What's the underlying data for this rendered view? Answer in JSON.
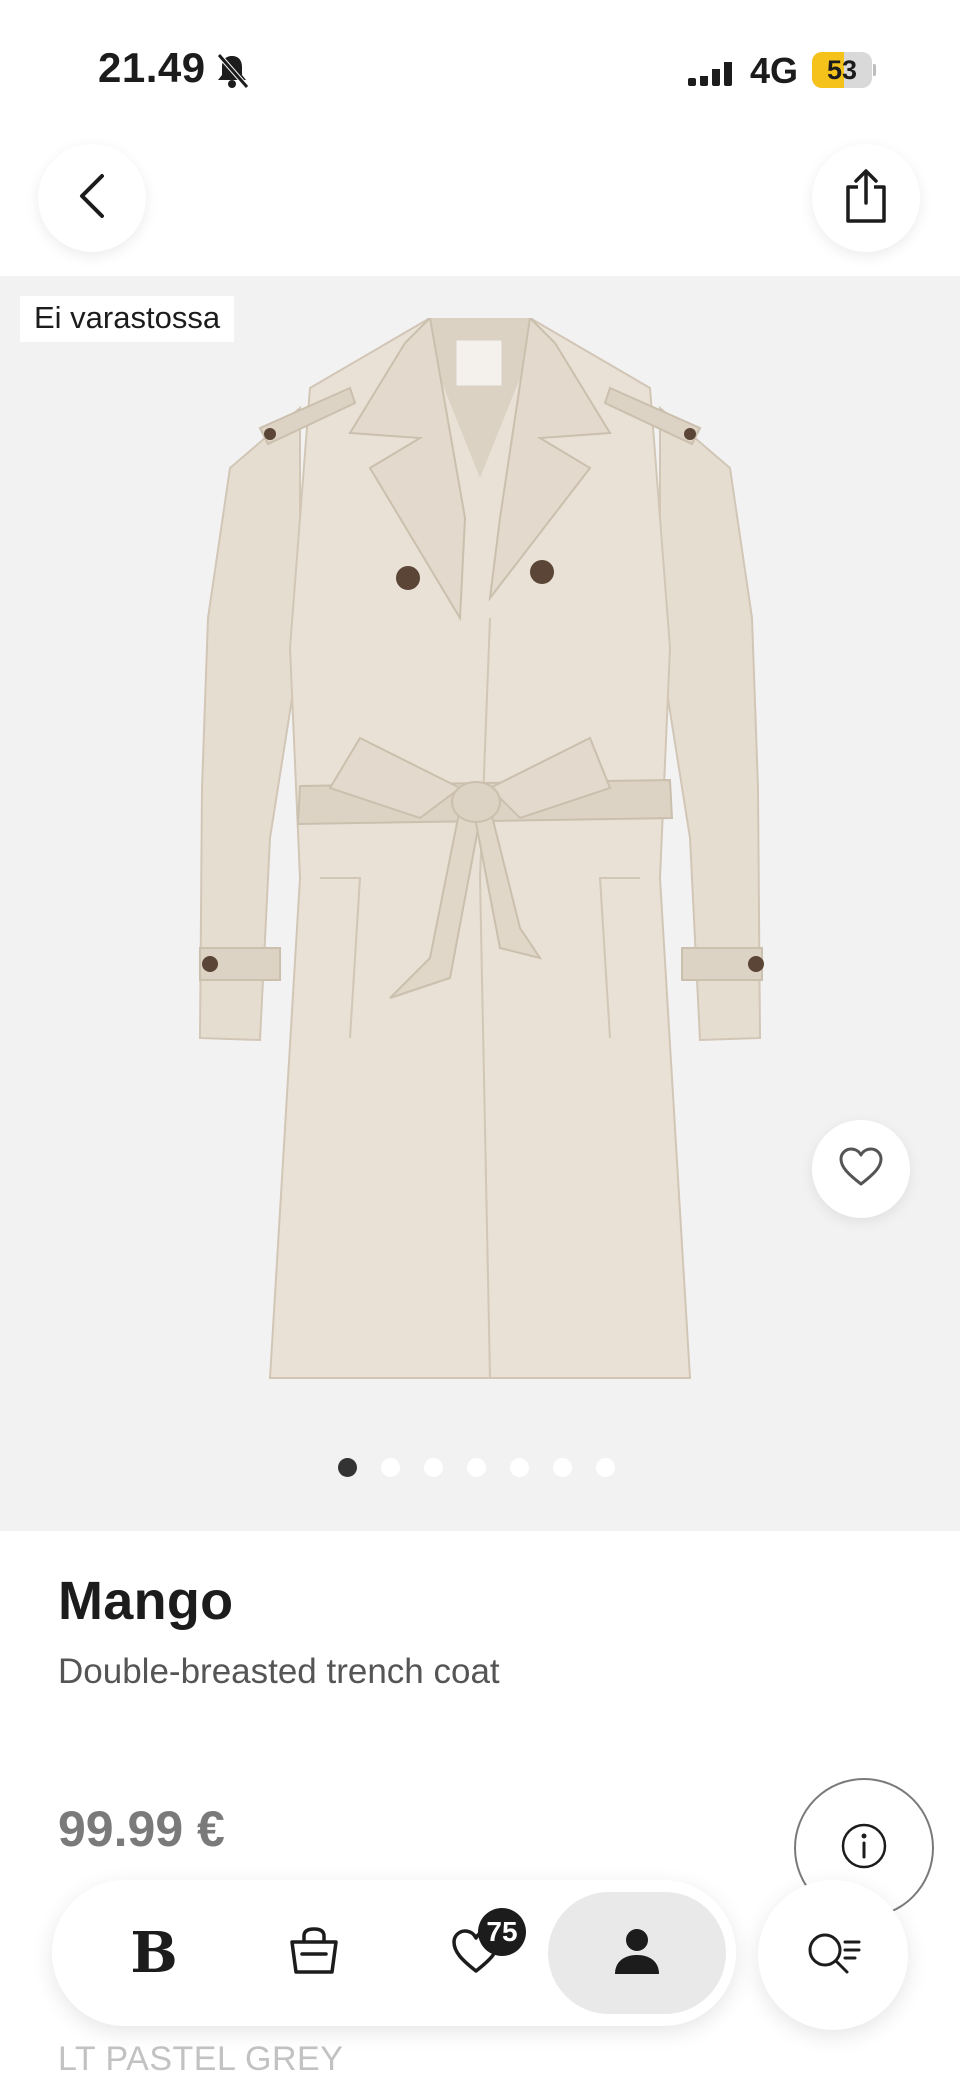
{
  "status_bar": {
    "time": "21.49",
    "network": "4G",
    "battery_level": "53",
    "battery_fraction": 0.53,
    "icons": [
      "bell-slash-icon",
      "signal-icon",
      "battery-icon"
    ]
  },
  "header": {
    "back_icon": "chevron-left-icon",
    "share_icon": "share-icon"
  },
  "product_image": {
    "badge": "Ei varastossa",
    "favorite_icon": "heart-outline-icon",
    "carousel": {
      "count": 7,
      "active_index": 0
    }
  },
  "product": {
    "brand": "Mango",
    "name": "Double-breasted trench coat",
    "price": "99.99 €",
    "color": "LT PASTEL GREY",
    "info_icon": "info-icon"
  },
  "bottom_nav": {
    "home_logo": "B",
    "bag_icon": "shopping-bag-icon",
    "wishlist_icon": "heart-icon",
    "wishlist_count": "75",
    "profile_icon": "person-icon",
    "active_item": "profile",
    "search_icon": "search-menu-icon"
  },
  "colors": {
    "accent_battery": "#f4c21a",
    "image_background": "#f3f2f3",
    "coat": "#e6ddd1",
    "text_primary": "#1c1c1c",
    "text_muted": "#7a7a7a"
  }
}
